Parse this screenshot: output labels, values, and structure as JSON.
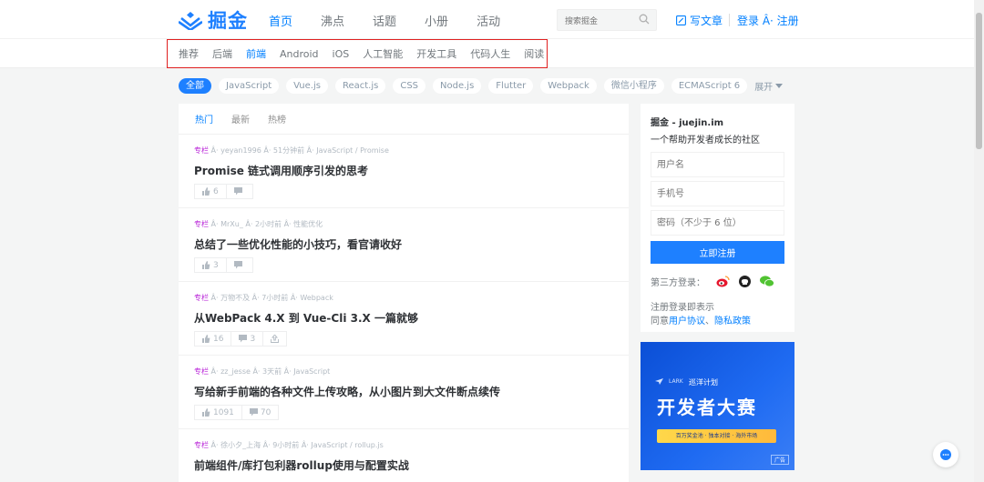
{
  "header": {
    "logo_text": "掘金",
    "nav": [
      "首页",
      "沸点",
      "话题",
      "小册",
      "活动"
    ],
    "search_placeholder": "搜索掘金",
    "write_label": "写文章",
    "auth_label": "登录 Â· 注册"
  },
  "subnav": {
    "items": [
      "推荐",
      "后端",
      "前端",
      "Android",
      "iOS",
      "人工智能",
      "开发工具",
      "代码人生",
      "阅读"
    ]
  },
  "tags": {
    "items": [
      "全部",
      "JavaScript",
      "Vue.js",
      "React.js",
      "CSS",
      "Node.js",
      "Flutter",
      "Webpack",
      "微信小程序",
      "ECMAScript 6"
    ],
    "more_label": "展开"
  },
  "feed": {
    "tabs": [
      "热门",
      "最新",
      "热榜"
    ],
    "entries": [
      {
        "category": "专栏",
        "meta": " Â· yeyan1996 Â· 51分钟前 Â· JavaScript / Promise",
        "title": "Promise 链式调用顺序引发的思考",
        "likes": "6",
        "comments": ""
      },
      {
        "category": "专栏",
        "meta": " Â· MrXu_ Â· 2小时前 Â· 性能优化",
        "title": "总结了一些优化性能的小技巧，看官请收好",
        "likes": "3",
        "comments": ""
      },
      {
        "category": "专栏",
        "meta": " Â· 万物不及 Â· 7小时前 Â· Webpack",
        "title": "从WebPack 4.X 到 Vue-Cli 3.X 一篇就够",
        "likes": "16",
        "comments": "3"
      },
      {
        "category": "专栏",
        "meta": " Â· zz_jesse Â· 3天前 Â· JavaScript",
        "title": "写给新手前端的各种文件上传攻略，从小图片到大文件断点续传",
        "likes": "1091",
        "comments": "70"
      },
      {
        "category": "专栏",
        "meta": " Â· 徐小夕_上海 Â· 9小时前 Â· JavaScript / rollup.js",
        "title": "前端组件/库打包利器rollup使用与配置实战",
        "likes": "",
        "comments": ""
      }
    ]
  },
  "sidebar": {
    "title": "掘金 - juejin.im",
    "subtitle": "一个帮助开发者成长的社区",
    "username_placeholder": "用户名",
    "phone_placeholder": "手机号",
    "password_placeholder": "密码（不少于 6 位）",
    "register_label": "立即注册",
    "third_party_label": "第三方登录：",
    "terms_line1": "注册登录即表示",
    "terms_prefix": "同意",
    "terms_link1": "用户协议",
    "terms_sep": "、",
    "terms_link2": "隐私政策"
  },
  "ad": {
    "brand": "LARK",
    "plan": "巡洋计划",
    "headline": "开发者大赛",
    "ribbon": "百万奖金池 · 独本对接 · 海外市场",
    "badge": "广告"
  },
  "colors": {
    "accent": "#1e80ff",
    "column_tag": "#b71ed7",
    "highlight_box": "#e02020"
  }
}
